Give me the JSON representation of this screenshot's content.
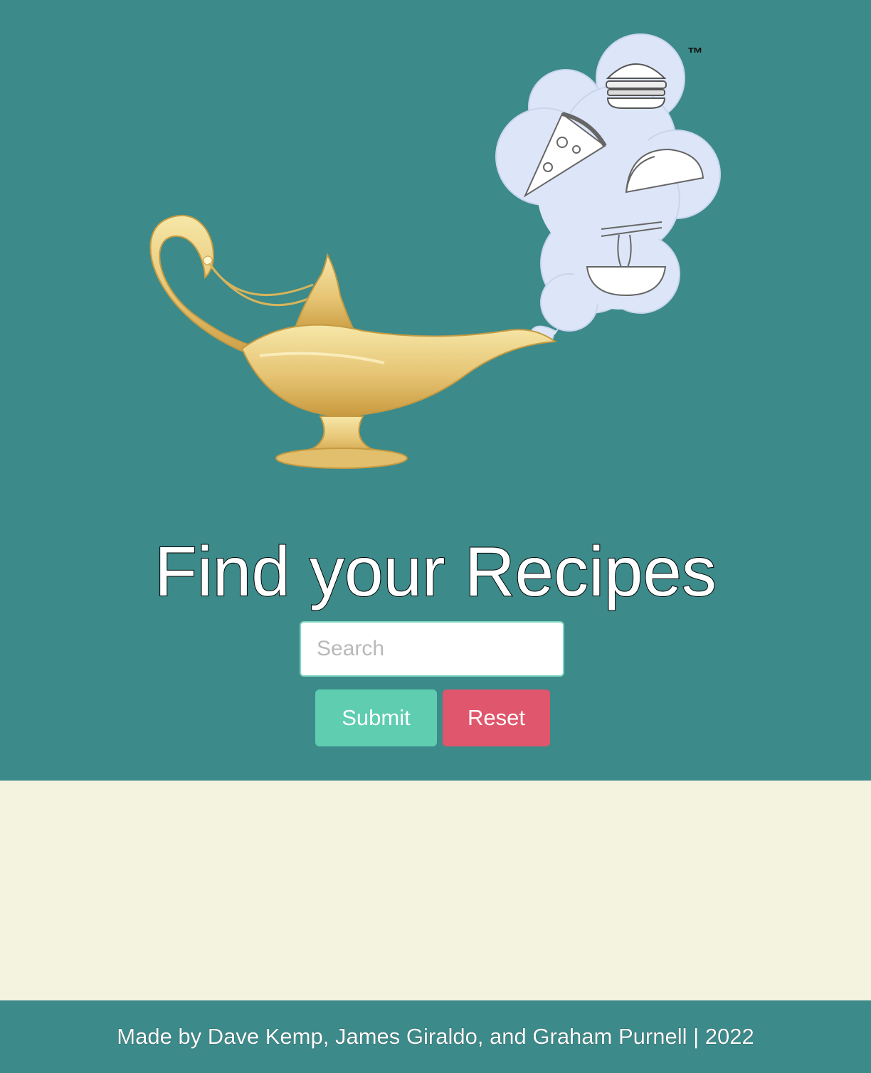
{
  "hero": {
    "logo": {
      "trademark": "™",
      "thought_items": [
        "burger-icon",
        "pizza-icon",
        "taco-icon",
        "ramen-icon"
      ]
    },
    "title": "Find your Recipes",
    "search": {
      "placeholder": "Search",
      "value": ""
    },
    "buttons": {
      "submit_label": "Submit",
      "reset_label": "Reset"
    }
  },
  "results": {
    "items": []
  },
  "footer": {
    "text": "Made by Dave Kemp, James Giraldo, and Graham Purnell | 2022"
  },
  "colors": {
    "hero_bg": "#3c8a8a",
    "results_bg": "#f4f3df",
    "submit": "#5ecdb0",
    "reset": "#e0566c",
    "lamp_gold": "#e8c874",
    "cloud": "#dde6f8"
  }
}
